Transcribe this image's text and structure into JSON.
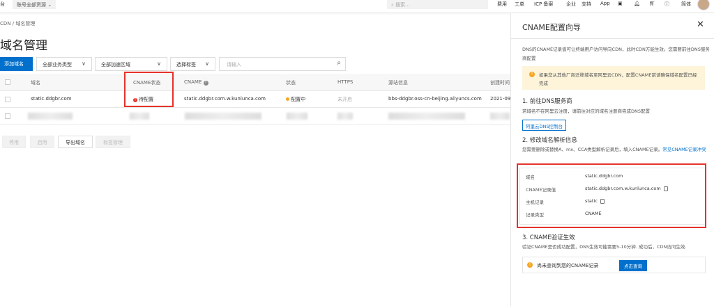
{
  "topbar": {
    "left_partial": "台",
    "resource_selector": "账号全部资源",
    "search_placeholder": "搜索...",
    "nav": [
      "费用",
      "工单",
      "ICP 备案",
      "企业",
      "支持",
      "App"
    ],
    "language": "简体"
  },
  "breadcrumb": [
    "CDN",
    "/",
    "域名管理"
  ],
  "page_title": "域名管理",
  "toolbar": {
    "add_domain": "添加域名",
    "business_type": "全部业务类型",
    "region": "全部加速区域",
    "tag": "选择标签",
    "search_placeholder": "请输入"
  },
  "table": {
    "headers": [
      "域名",
      "CNAME状态",
      "CNAME",
      "状态",
      "HTTPS",
      "源站信息",
      "创建时间"
    ],
    "rows": [
      {
        "domain": "static.ddgbr.com",
        "cname_status": "待配置",
        "cname": "static.ddgbr.com.w.kunlunca.com",
        "status": "配置中",
        "https": "未开启",
        "origin": "bbs-ddgbr.oss-cn-beijing.aliyuncs.com",
        "created": "2021-09-"
      }
    ]
  },
  "bulk_actions": [
    "停用",
    "启用",
    "导出域名",
    "标签管理"
  ],
  "panel": {
    "title": "CNAME配置向导",
    "intro": "DNS的CNAME记录值可让终端用户访问导向CDN，此时CDN方能生效。您需要前往DNS服务商配置",
    "warning": "如果您从其他厂商迁移域名至阿里云CDN，配置CNAME前请确保域名配置已经完成",
    "step1_title": "1. 前往DNS服务商",
    "step1_text": "若域名不在阿里云注册，请前往对应的域名注册商完成DNS配置",
    "step1_button": "阿里云DNS控制台",
    "step2_title": "2. 修改域名解析信息",
    "step2_text": "您需要删除或替换A、mx、CCA类型解析记录后，填入CNAME记录。",
    "step2_link": "常见CNAME记录冲突",
    "records": [
      {
        "key": "域名",
        "value": "static.ddgbr.com",
        "copy": false
      },
      {
        "key": "CNAME记录值",
        "value": "static.ddgbr.com.w.kunlunca.com",
        "copy": true
      },
      {
        "key": "主机记录",
        "value": "static",
        "copy": true
      },
      {
        "key": "记录类型",
        "value": "CNAME",
        "copy": false
      }
    ],
    "step3_title": "3. CNAME验证生效",
    "step3_text": "验证CNAME是否成功配置，DNS生效可能需要5-10分钟. 成功后，CDN访问生效.",
    "result_text": "尚未查询到您的CNAME记录",
    "query_button": "点击查询"
  }
}
